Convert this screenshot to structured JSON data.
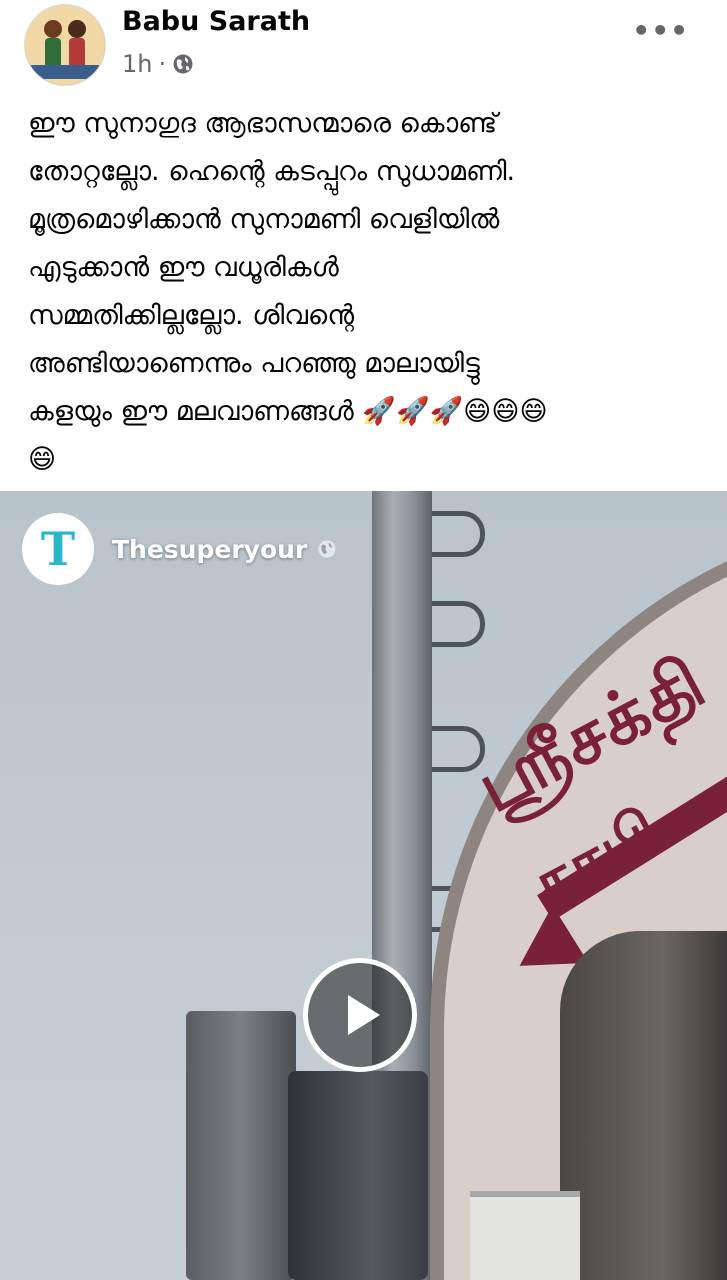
{
  "post": {
    "author": "Babu Sarath",
    "time": "1h",
    "separator": "·",
    "privacy_icon": "globe-icon",
    "more_icon": "more-dots-icon",
    "more_glyph": "•••",
    "text": "ഈ സുനാഗുദ ആഭാസന്മാരെ കൊണ്ട്\nതോറ്റല്ലോ. ഹെന്റെ കടപ്പുറം സുധാമണി.\nമൂത്രമൊഴിക്കാൻ സുനാമണി വെളിയിൽ\nഎടുക്കാൻ ഈ വധൂരികൾ\nസമ്മതിക്കില്ലല്ലോ. ശിവന്റെ\nഅണ്ടിയാണെന്നും പറഞ്ഞു മാലായിട്ടു\nകളയും ഈ മലവാണങ്ങൾ 🚀🚀🚀😄😄😄\n😄"
  },
  "video": {
    "page_name": "Thesuperyour",
    "page_logo_letter": "T",
    "play_icon": "play-icon",
    "colors": {
      "logo_teal": "#26b8c9",
      "sign_text": "#7a2235"
    }
  }
}
